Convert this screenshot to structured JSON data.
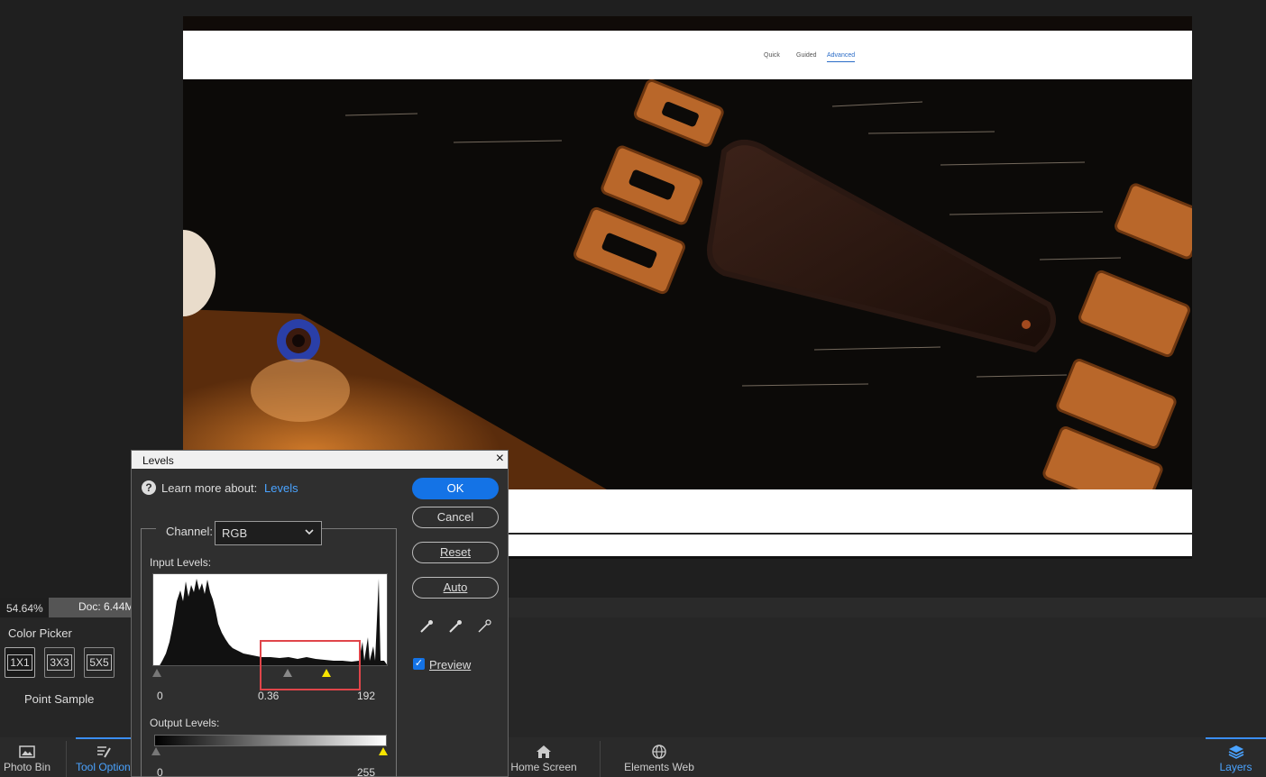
{
  "document": {
    "tabs": [
      "Quick",
      "Guided",
      "Advanced"
    ]
  },
  "status": {
    "zoom": "54.64%",
    "doc": "Doc: 6.44M"
  },
  "tool_options": {
    "title": "Color Picker",
    "sizes": [
      "1X1",
      "3X3",
      "5X5"
    ],
    "sample_label": "Point Sample"
  },
  "bottom_bar": {
    "photo_bin": "Photo Bin",
    "tool_options": "Tool Options",
    "home_screen": "Home Screen",
    "elements_web": "Elements Web",
    "layers": "Layers"
  },
  "levels": {
    "title": "Levels",
    "close": "×",
    "help_icon": "?",
    "learn_label": "Learn more about:",
    "learn_link": "Levels",
    "channel_label": "Channel:",
    "channel_value": "RGB",
    "input_label": "Input Levels:",
    "input_black": "0",
    "input_mid": "0.36",
    "input_white": "192",
    "output_label": "Output Levels:",
    "output_black": "0",
    "output_white": "255",
    "ok": "OK",
    "cancel": "Cancel",
    "reset": "Reset",
    "auto": "Auto",
    "preview": "Preview",
    "preview_checked": "✓"
  },
  "colors": {
    "accent": "#1473e6",
    "highlight": "#e0454a",
    "white_slider": "#f7e400"
  }
}
